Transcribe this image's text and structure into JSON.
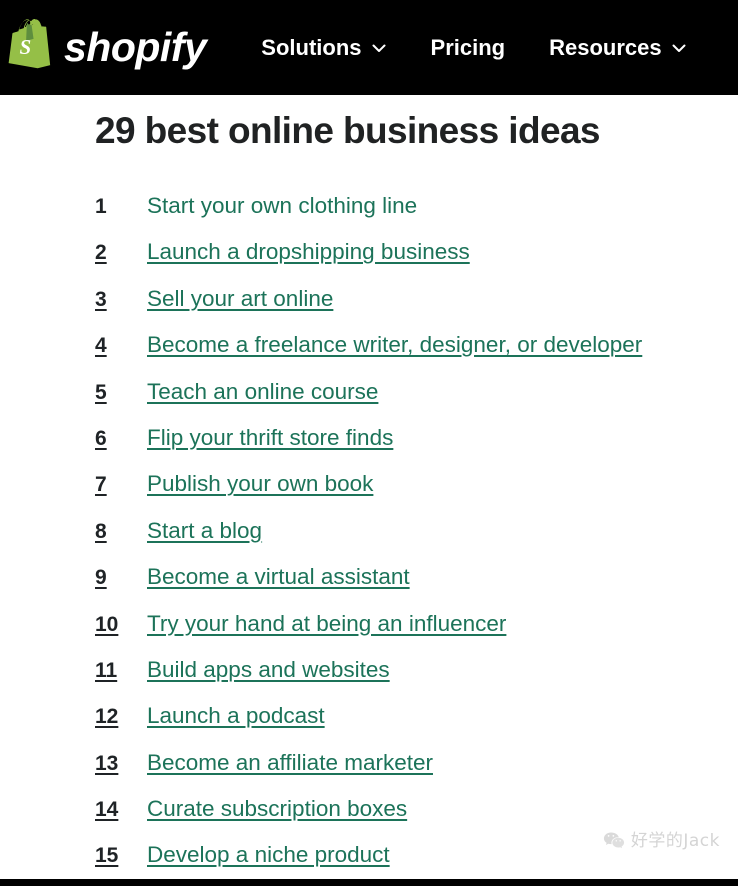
{
  "header": {
    "background_color": "#000000",
    "logo": {
      "name": "shopify",
      "wordmark": "shopify",
      "bag_color": "#95bf47",
      "bag_shade_color": "#5e8e3e",
      "letter": "s",
      "letter_color": "#ffffff"
    },
    "nav_items": [
      {
        "label": "Solutions",
        "has_chevron": true
      },
      {
        "label": "Pricing",
        "has_chevron": false
      },
      {
        "label": "Resources",
        "has_chevron": true
      }
    ]
  },
  "article": {
    "title": "29 best online business ideas",
    "title_color": "#202223",
    "link_color": "#1c7359",
    "number_color": "#1f2326",
    "items": [
      {
        "num": "1",
        "label": "Start your own clothing line",
        "underlined": false
      },
      {
        "num": "2",
        "label": "Launch a dropshipping business",
        "underlined": true
      },
      {
        "num": "3",
        "label": "Sell your art online",
        "underlined": true
      },
      {
        "num": "4",
        "label": "Become a freelance writer, designer, or developer",
        "underlined": true
      },
      {
        "num": "5",
        "label": "Teach an online course",
        "underlined": true
      },
      {
        "num": "6",
        "label": "Flip your thrift store finds",
        "underlined": true
      },
      {
        "num": "7",
        "label": "Publish your own book",
        "underlined": true
      },
      {
        "num": "8",
        "label": "Start a blog",
        "underlined": true
      },
      {
        "num": "9",
        "label": "Become a virtual assistant",
        "underlined": true
      },
      {
        "num": "10",
        "label": "Try your hand at being an influencer",
        "underlined": true
      },
      {
        "num": "11",
        "label": "Build apps and websites",
        "underlined": true
      },
      {
        "num": "12",
        "label": "Launch a podcast",
        "underlined": true
      },
      {
        "num": "13",
        "label": "Become an affiliate marketer",
        "underlined": true
      },
      {
        "num": "14",
        "label": "Curate subscription boxes",
        "underlined": true
      },
      {
        "num": "15",
        "label": "Develop a niche product",
        "underlined": true
      }
    ]
  },
  "watermark": {
    "text": "好学的Jack",
    "icon": "wechat-icon",
    "color": "#9a9a9a"
  }
}
